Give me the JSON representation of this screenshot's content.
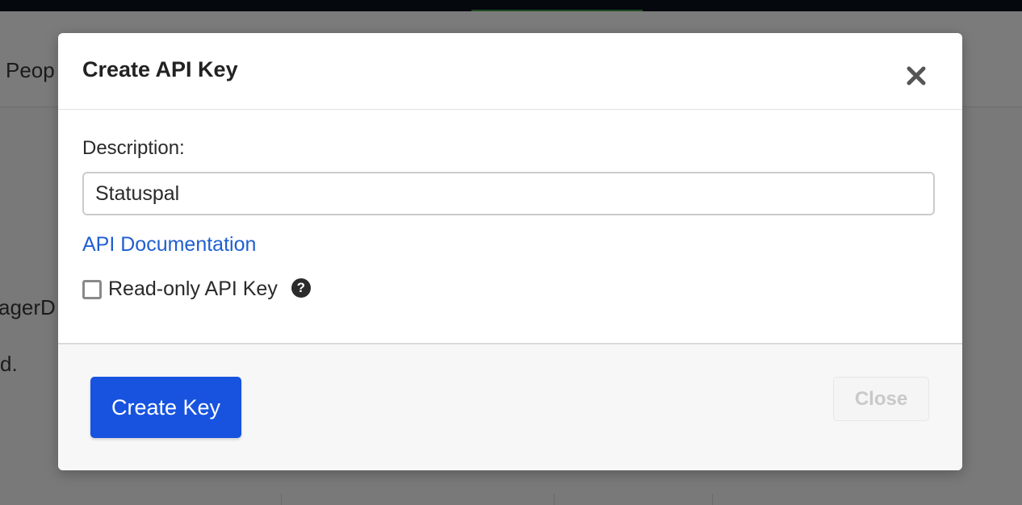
{
  "background": {
    "nav_fragment": "Peop",
    "text_fragment_1": "agerD",
    "text_fragment_2": "d."
  },
  "modal": {
    "title": "Create API Key",
    "close_icon": "close-icon",
    "description_label": "Description:",
    "description_value": "Statuspal",
    "doc_link": "API Documentation",
    "readonly_label": "Read-only API Key",
    "readonly_checked": false,
    "help_icon": "question-circle-icon",
    "help_glyph": "?",
    "create_button": "Create Key",
    "close_button": "Close"
  },
  "colors": {
    "primary": "#1853e0",
    "link": "#1f5fd0"
  }
}
